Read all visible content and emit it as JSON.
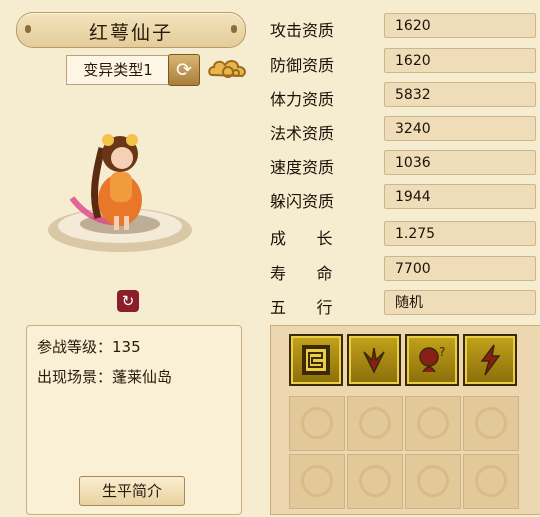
{
  "pet": {
    "name": "红萼仙子",
    "variant_label": "变异类型1",
    "level_label": "参战等级：",
    "level_value": "135",
    "location_label": "出现场景：",
    "location_value": "蓬莱仙岛",
    "bio_button": "生平简介"
  },
  "attributes": [
    {
      "label": "攻击资质",
      "value": "1620"
    },
    {
      "label": "防御资质",
      "value": "1620"
    },
    {
      "label": "体力资质",
      "value": "5832"
    },
    {
      "label": "法术资质",
      "value": "3240"
    },
    {
      "label": "速度资质",
      "value": "1036"
    },
    {
      "label": "躲闪资质",
      "value": "1944"
    },
    {
      "label": "成      长",
      "value": "1.275"
    },
    {
      "label": "寿      命",
      "value": "7700"
    },
    {
      "label": "五      行",
      "value": "随机"
    }
  ],
  "skills": [
    "scroll-skill-icon",
    "eagle-skill-icon",
    "mystery-orb-skill-icon",
    "lightning-skill-icon"
  ],
  "colors": {
    "background": "#f6ecd0",
    "skill_gold": "#c3a21a",
    "rotate_button": "#8a1f2a"
  }
}
